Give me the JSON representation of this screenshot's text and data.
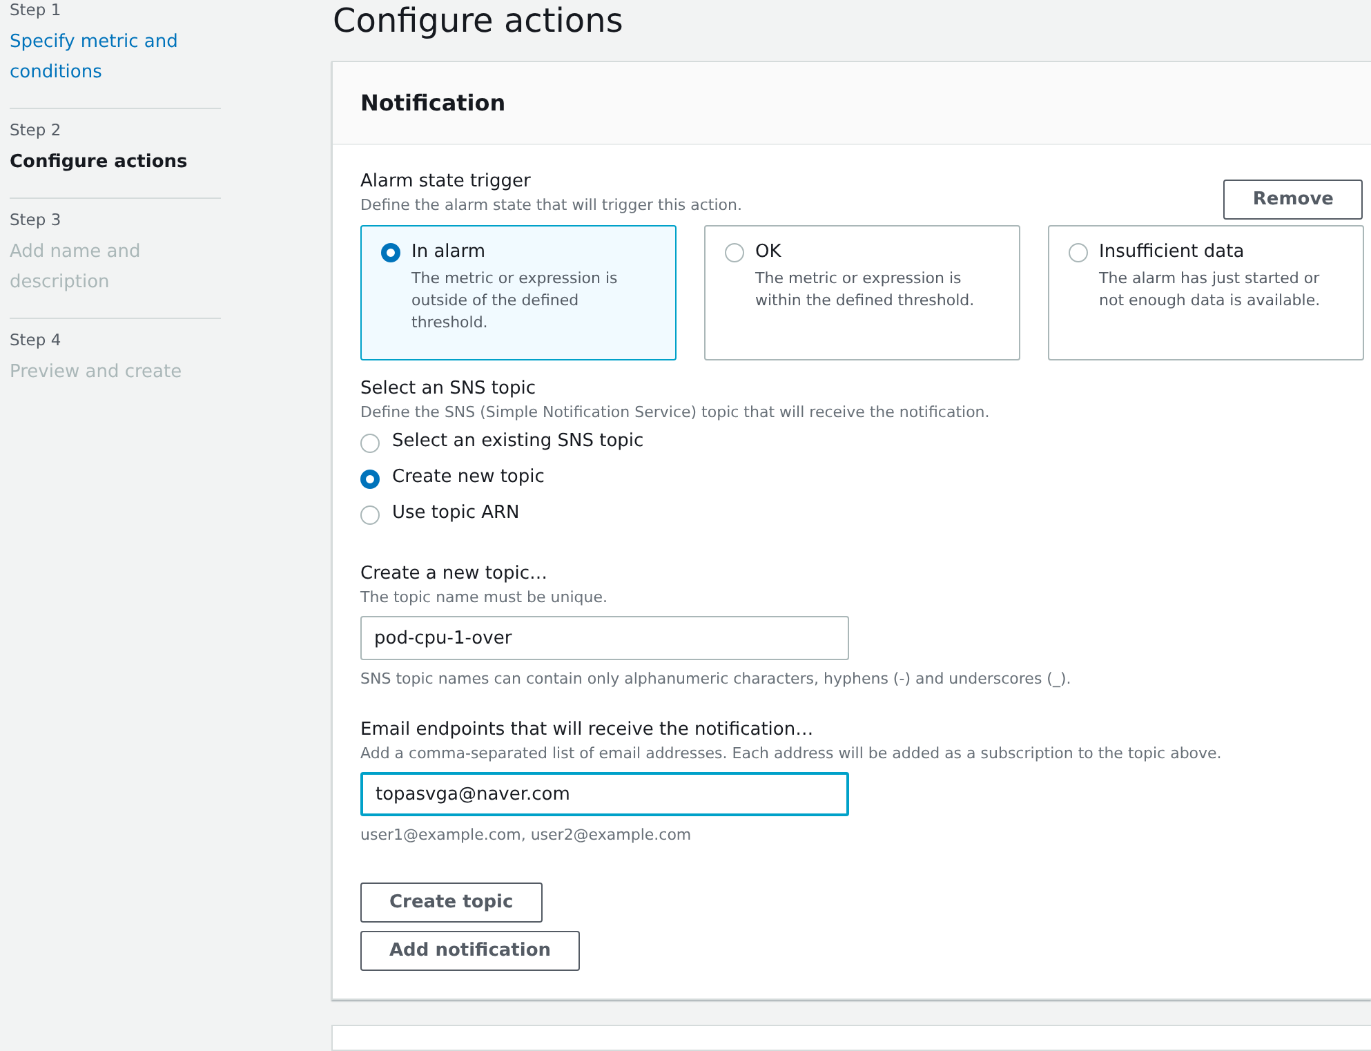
{
  "steps": [
    {
      "step": "Step 1",
      "title": "Specify metric and conditions",
      "selected": false,
      "disabled": false
    },
    {
      "step": "Step 2",
      "title": "Configure actions",
      "selected": true,
      "disabled": false
    },
    {
      "step": "Step 3",
      "title": "Add name and description",
      "selected": false,
      "disabled": true
    },
    {
      "step": "Step 4",
      "title": "Preview and create",
      "selected": false,
      "disabled": true
    }
  ],
  "page_title": "Configure actions",
  "notification": {
    "title": "Notification",
    "remove_button": "Remove",
    "trigger": {
      "label": "Alarm state trigger",
      "description": "Define the alarm state that will trigger this action.",
      "options": [
        {
          "label": "In alarm",
          "description": "The metric or expression is outside of the defined threshold.",
          "selected": true
        },
        {
          "label": "OK",
          "description": "The metric or expression is within the defined threshold.",
          "selected": false
        },
        {
          "label": "Insufficient data",
          "description": "The alarm has just started or not enough data is available.",
          "selected": false
        }
      ]
    },
    "sns": {
      "label": "Select an SNS topic",
      "description": "Define the SNS (Simple Notification Service) topic that will receive the notification.",
      "options": [
        {
          "label": "Select an existing SNS topic",
          "selected": false
        },
        {
          "label": "Create new topic",
          "selected": true
        },
        {
          "label": "Use topic ARN",
          "selected": false
        }
      ]
    },
    "fields": [
      {
        "label": "Create a new topic…",
        "description": "The topic name must be unique.",
        "value": "pod-cpu-1-over",
        "hint": "SNS topic names can contain only alphanumeric characters, hyphens (-) and underscores (_).",
        "focused": false
      },
      {
        "label": "Email endpoints that will receive the notification…",
        "description": "Add a comma-separated list of email addresses. Each address will be added as a subscription to the topic above.",
        "value": "topasvga@naver.com",
        "hint": "user1@example.com, user2@example.com",
        "focused": true
      }
    ],
    "create_topic_button": "Create topic",
    "add_notification_button": "Add notification"
  }
}
